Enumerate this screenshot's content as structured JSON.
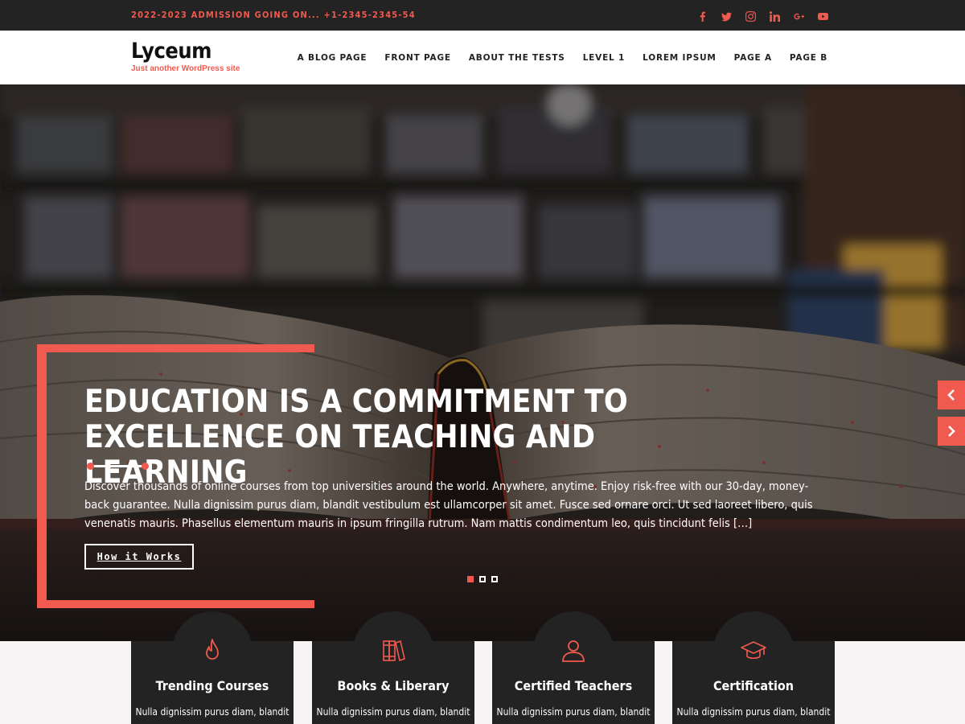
{
  "topbar": {
    "admission_text": "2022-2023 ADMISSION GOING ON... +1-2345-2345-54",
    "social": [
      "facebook-icon",
      "twitter-icon",
      "instagram-icon",
      "linkedin-icon",
      "google-plus-icon",
      "youtube-icon"
    ]
  },
  "header": {
    "site_title": "Lyceum",
    "tagline": "Just another WordPress site",
    "nav": [
      "A BLOG PAGE",
      "FRONT PAGE",
      "ABOUT THE TESTS",
      "LEVEL 1",
      "LOREM IPSUM",
      "PAGE A",
      "PAGE B"
    ]
  },
  "hero": {
    "title": "EDUCATION IS A COMMITMENT TO EXCELLENCE ON TEACHING AND LEARNING",
    "text": "Discover thousands of online courses from top universities around the world. Anywhere, anytime. Enjoy risk-free with our 30-day, money-back guarantee. Nulla dignissim purus diam, blandit vestibulum est ullamcorper sit amet. Fusce sed ornare orci. Ut sed laoreet libero, quis venenatis mauris. Phasellus elementum mauris in ipsum fringilla rutrum. Nam mattis condimentum leo, quis tincidunt felis […]",
    "button_label": "How it Works",
    "slides_count": 3,
    "active_slide": 1
  },
  "features": [
    {
      "icon": "fire-icon",
      "title": "Trending Courses",
      "text": "Nulla dignissim purus diam, blandit"
    },
    {
      "icon": "books-icon",
      "title": "Books & Liberary",
      "text": "Nulla dignissim purus diam, blandit"
    },
    {
      "icon": "user-icon",
      "title": "Certified Teachers",
      "text": "Nulla dignissim purus diam, blandit"
    },
    {
      "icon": "graduation-cap-icon",
      "title": "Certification",
      "text": "Nulla dignissim purus diam, blandit"
    }
  ],
  "colors": {
    "accent": "#f05a4f",
    "dark": "#232323"
  }
}
